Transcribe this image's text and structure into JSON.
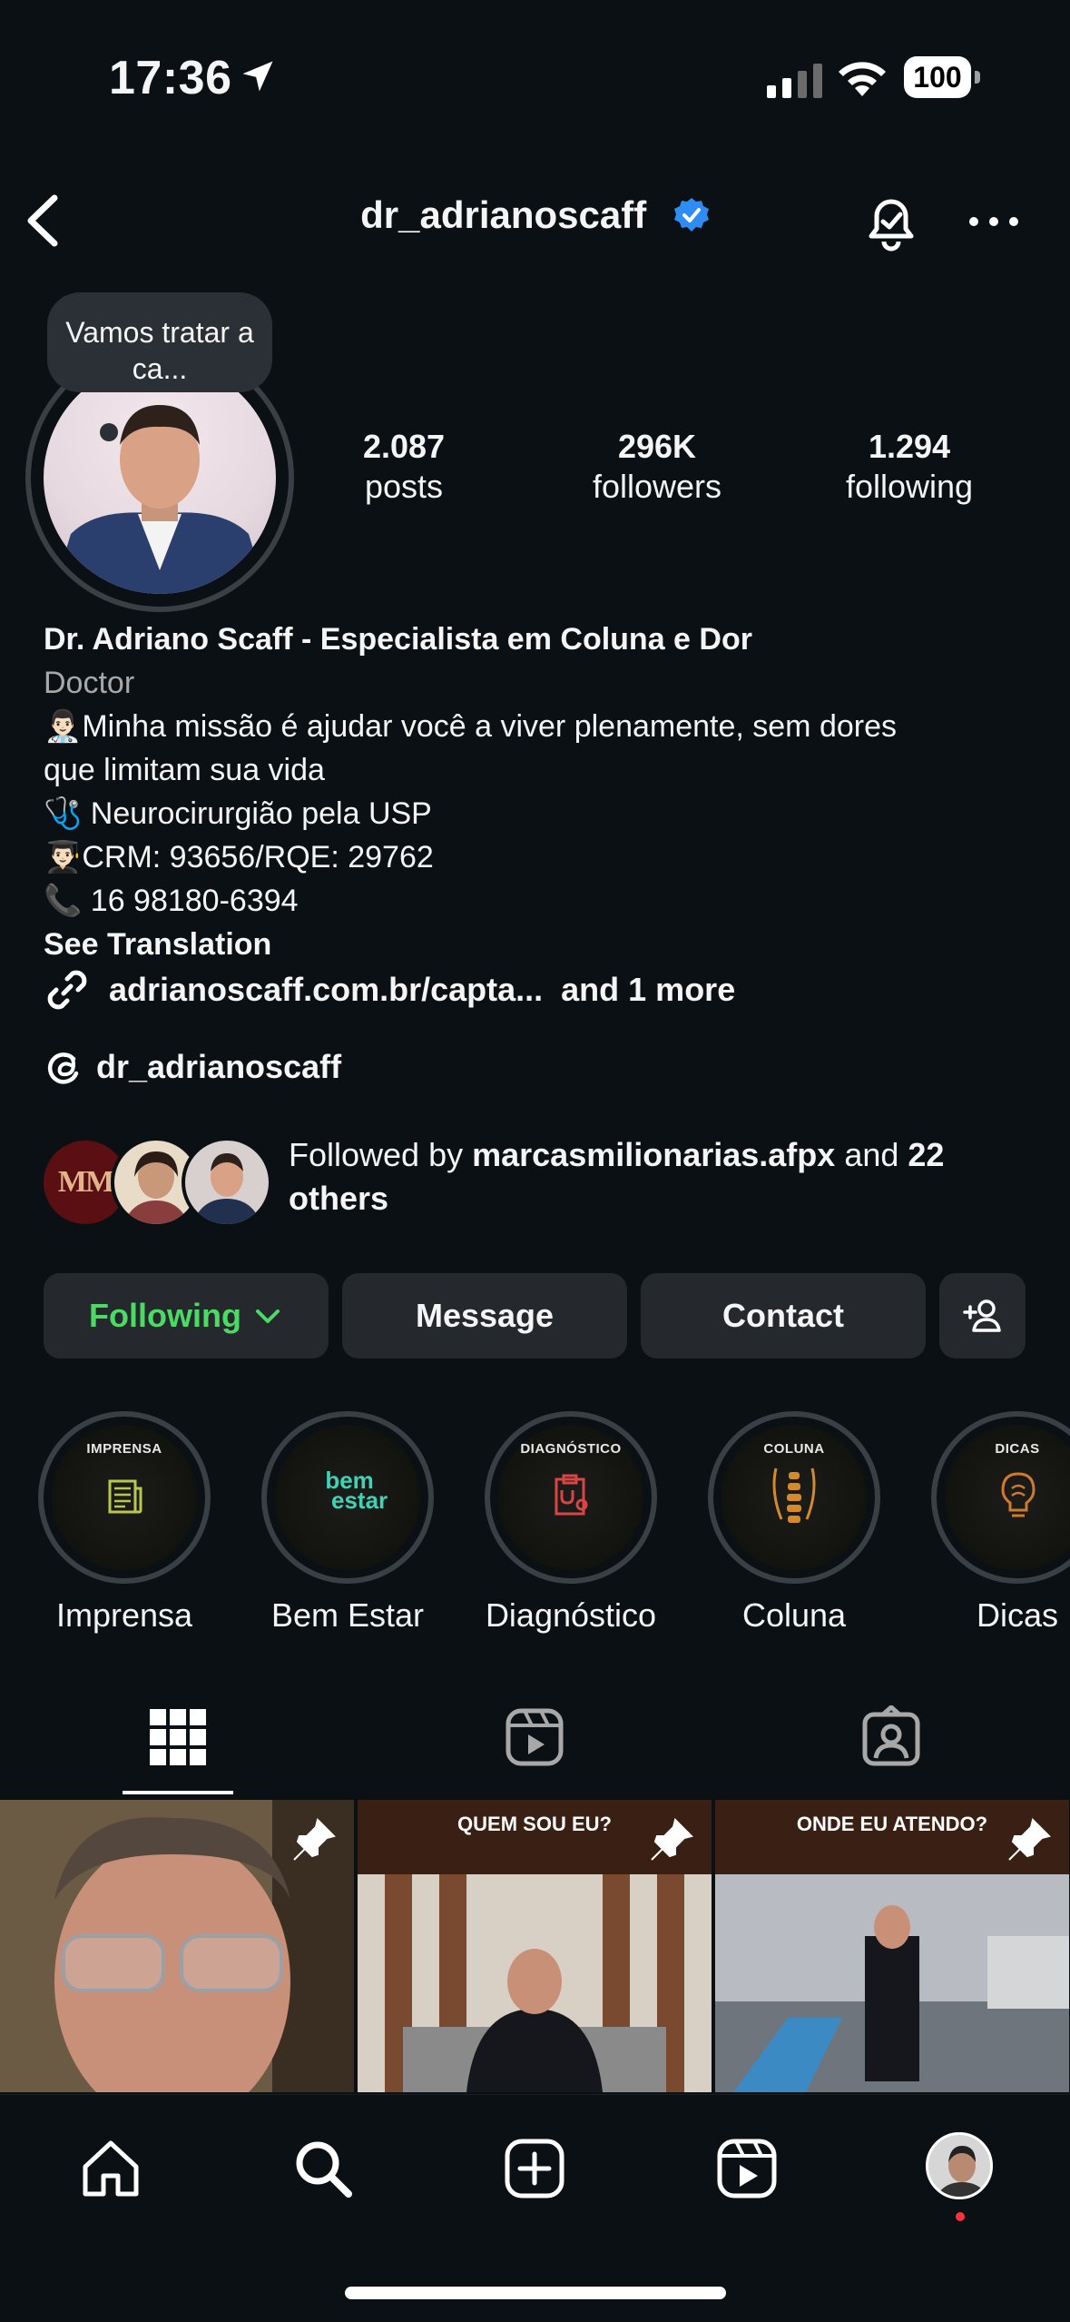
{
  "status_bar": {
    "time": "17:36",
    "battery": "100"
  },
  "header": {
    "username": "dr_adrianoscaff"
  },
  "profile": {
    "note": "Vamos tratar a ca...",
    "stats": [
      {
        "value": "2.087",
        "label": "posts"
      },
      {
        "value": "296K",
        "label": "followers"
      },
      {
        "value": "1.294",
        "label": "following"
      }
    ],
    "name": "Dr. Adriano Scaff - Especialista em Coluna e Dor",
    "category": "Doctor",
    "bio_lines": [
      "👨🏻‍⚕️Minha missão é ajudar você a viver plenamente, sem dores",
      "que limitam sua vida",
      "🩺 Neurocirurgião pela USP",
      "👨🏻‍🎓CRM: 93656/RQE: 29762",
      "📞 16 98180-6394"
    ],
    "see_translation": "See Translation",
    "link": "adrianoscaff.com.br/capta...",
    "link_more": "and 1 more",
    "threads_handle": "dr_adrianoscaff",
    "followed_by_prefix": "Followed by ",
    "followed_by_user": "marcasmilionarias.afpx",
    "followed_by_and": " and ",
    "followed_by_others": "22 others",
    "mm_logo": "MM"
  },
  "buttons": {
    "following": "Following",
    "message": "Message",
    "contact": "Contact"
  },
  "highlights": [
    {
      "title": "IMPRENSA",
      "label": "Imprensa",
      "color": "#b9c84a"
    },
    {
      "title": "",
      "label": "Bem Estar",
      "color": "#3fd2b4"
    },
    {
      "title": "DIAGNÓSTICO",
      "label": "Diagnóstico",
      "color": "#d94545"
    },
    {
      "title": "COLUNA",
      "label": "Coluna",
      "color": "#d58a2a"
    },
    {
      "title": "DICAS",
      "label": "Dicas",
      "color": "#d07a2a"
    }
  ],
  "bem_estar_logo": {
    "line1": "bem",
    "line2": "estar"
  },
  "posts": [
    {
      "caption": ""
    },
    {
      "caption": "QUEM SOU EU?"
    },
    {
      "caption": "ONDE EU ATENDO?"
    }
  ],
  "colors": {
    "background": "#0b1014",
    "following_green": "#4cd964",
    "verified_blue": "#2f8cf5",
    "button_bg": "#25292e"
  }
}
